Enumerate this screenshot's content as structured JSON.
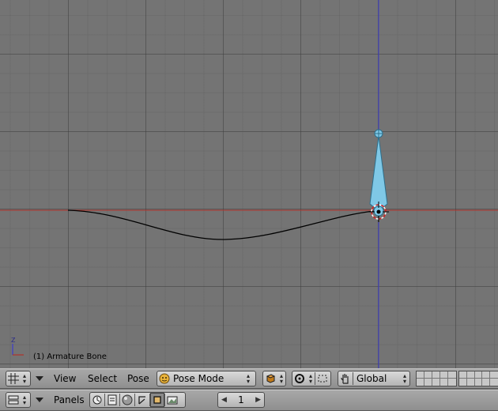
{
  "viewport": {
    "status_text": "(1) Armature Bone",
    "axis_label": "Z",
    "grid_color": "#646464",
    "x_axis_color": "#c0392b",
    "z_axis_color": "#3b3bd6",
    "bone_color": "#7fc8e6",
    "curve_color": "#000000"
  },
  "header_3d": {
    "menus": {
      "view": "View",
      "select": "Select",
      "pose": "Pose"
    },
    "mode": {
      "icon": "pose-mode-icon",
      "label": "Pose Mode"
    },
    "orientation": {
      "label": "Global"
    }
  },
  "header_buttons": {
    "panels_label": "Panels",
    "frame_value": "1"
  }
}
